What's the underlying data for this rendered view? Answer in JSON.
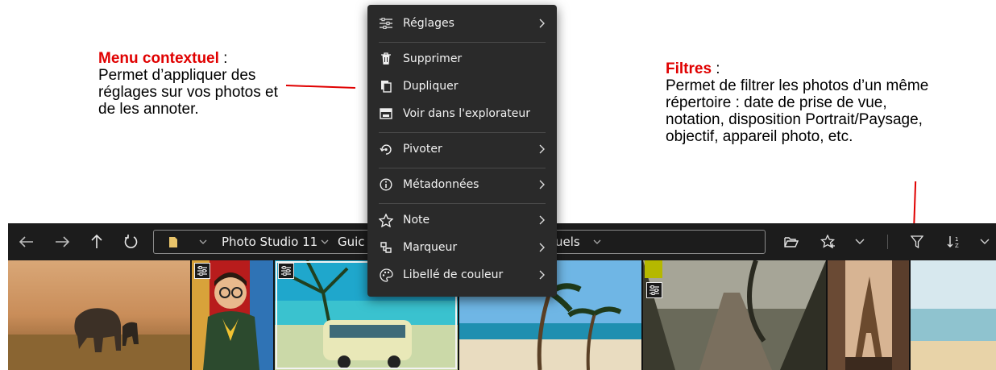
{
  "annotations": {
    "context_menu": {
      "title": "Menu contextuel",
      "title_suffix": " :",
      "lines": [
        "Permet d’appliquer des",
        "réglages sur vos photos et",
        "de les annoter."
      ]
    },
    "filters": {
      "title": "Filtres",
      "title_suffix": " :",
      "lines": [
        "Permet de filtrer les photos d’un même",
        "répertoire : date de prise de vue,",
        "notation, disposition Portrait/Paysage,",
        "objectif, appareil photo, etc."
      ]
    }
  },
  "colors": {
    "annotation_accent": "#e00000",
    "toolbar_bg": "#1c1c1c",
    "menu_bg": "#2a2a2a",
    "color_label_chip": "#b5b800"
  },
  "toolbar": {
    "back_icon": "arrow-left-icon",
    "forward_icon": "arrow-right-icon",
    "up_icon": "arrow-up-icon",
    "refresh_icon": "refresh-icon",
    "breadcrumbs": [
      "Photo Studio 11",
      "Guic",
      "uels"
    ],
    "open_folder_icon": "open-folder-icon",
    "favorites_icon": "star-plus-icon",
    "filter_icon": "filter-icon",
    "sort_icon": "sort-icon"
  },
  "context_menu": {
    "items": [
      {
        "label": "Réglages",
        "icon": "sliders-icon",
        "submenu": true
      },
      {
        "label": "Supprimer",
        "icon": "trash-icon",
        "submenu": false
      },
      {
        "label": "Dupliquer",
        "icon": "copy-icon",
        "submenu": false
      },
      {
        "label": "Voir dans l'explorateur",
        "icon": "explorer-icon",
        "submenu": false
      },
      {
        "label": "Pivoter",
        "icon": "rotate-icon",
        "submenu": true
      },
      {
        "label": "Métadonnées",
        "icon": "info-icon",
        "submenu": true
      },
      {
        "label": "Note",
        "icon": "star-icon",
        "submenu": true
      },
      {
        "label": "Marqueur",
        "icon": "marker-icon",
        "submenu": true
      },
      {
        "label": "Libellé de couleur",
        "icon": "palette-icon",
        "submenu": true
      }
    ]
  },
  "thumbnails": [
    {
      "subject": "elephants-savanna"
    },
    {
      "subject": "child-with-glasses",
      "adjusted": true
    },
    {
      "subject": "vintage-van-beach",
      "adjusted": true,
      "selected": true
    },
    {
      "subject": "palm-trees-beach"
    },
    {
      "subject": "forest-stairs",
      "adjusted": true,
      "color_label": true
    },
    {
      "subject": "eiffel-tower"
    },
    {
      "subject": "sea-shore"
    }
  ]
}
